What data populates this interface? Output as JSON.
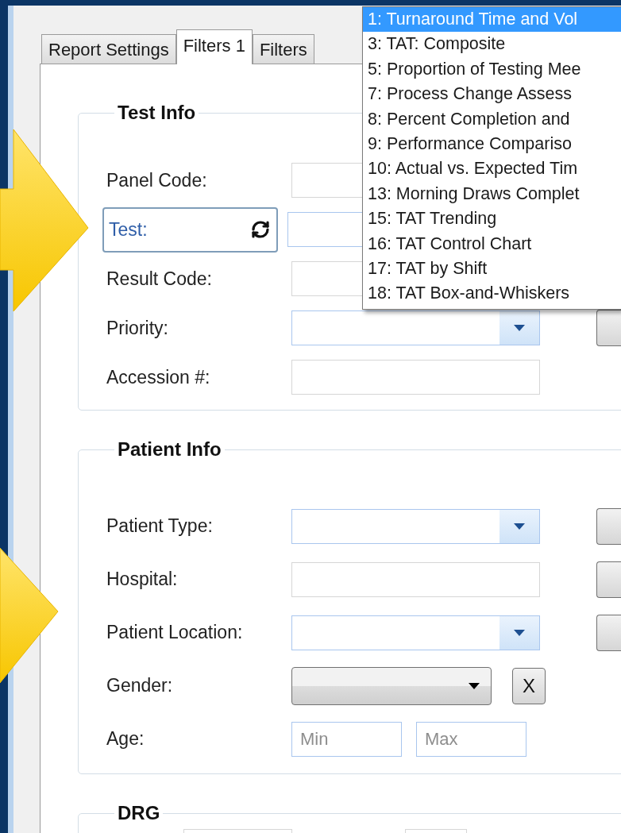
{
  "tabs": [
    {
      "label": "Report Settings",
      "selected": false
    },
    {
      "label": "Filters 1",
      "selected": true
    },
    {
      "label": "Filters",
      "selected": false
    }
  ],
  "report_list": {
    "items": [
      {
        "label": "1: Turnaround Time and Vol",
        "selected": true
      },
      {
        "label": "3: TAT: Composite",
        "selected": false
      },
      {
        "label": "5: Proportion of Testing Mee",
        "selected": false
      },
      {
        "label": "7: Process Change Assess",
        "selected": false
      },
      {
        "label": "8: Percent Completion and",
        "selected": false
      },
      {
        "label": "9: Performance Compariso",
        "selected": false
      },
      {
        "label": "10: Actual vs. Expected Tim",
        "selected": false
      },
      {
        "label": "13: Morning Draws Complet",
        "selected": false
      },
      {
        "label": "15: TAT Trending",
        "selected": false
      },
      {
        "label": "16: TAT Control Chart",
        "selected": false
      },
      {
        "label": "17: TAT by Shift",
        "selected": false
      },
      {
        "label": "18: TAT Box-and-Whiskers",
        "selected": false
      }
    ]
  },
  "test_info": {
    "title": "Test Info",
    "fields": [
      {
        "kind": "text",
        "label": "Panel Code:"
      },
      {
        "kind": "lookup",
        "label": "Test:"
      },
      {
        "kind": "text",
        "label": "Result Code:"
      },
      {
        "kind": "combo",
        "label": "Priority:",
        "side_button": true
      },
      {
        "kind": "text",
        "label": "Accession #:",
        "side_button": false
      }
    ]
  },
  "patient_info": {
    "title": "Patient Info",
    "fields": [
      {
        "kind": "combo",
        "label": "Patient Type:",
        "side_button": true
      },
      {
        "kind": "text",
        "label": "Hospital:",
        "side_button": true
      },
      {
        "kind": "combo",
        "label": "Patient Location:",
        "side_button": true
      },
      {
        "kind": "select",
        "label": "Gender:",
        "clear": "X",
        "side_button": false
      },
      {
        "kind": "range",
        "label": "Age:",
        "min_placeholder": "Min",
        "max_placeholder": "Max",
        "side_button": false
      }
    ]
  },
  "drg": {
    "title": "DRG"
  }
}
